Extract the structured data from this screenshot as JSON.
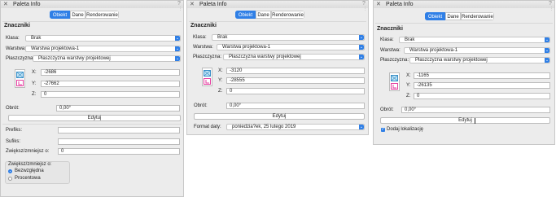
{
  "window_title": "Paleta Info",
  "help_glyph": "?",
  "tabs": [
    "Obiekt",
    "Dane",
    "Renderowanie"
  ],
  "section_title": "Znaczniki",
  "labels": {
    "klasa": "Klasa:",
    "warstwa": "Warstwa:",
    "plaszczyzna": "Płaszczyzna:",
    "x": "X:",
    "y": "Y:",
    "z": "Z:",
    "obrot": "Obrót:",
    "edytuj": "Edytuj",
    "prefiks": "Prefiks:",
    "sufiks": "Sufiks:",
    "zwieksz": "Zwiększ/zmniejsz o:",
    "zwieksz_group": "Zwiększ/zmniejsz o:",
    "bezwzgledna": "Bezwzględna",
    "procentowa": "Procentowa",
    "format_daty": "Format daty:",
    "dodaj_lokalizacje": "Dodaj lokalizację"
  },
  "common": {
    "klasa_value": "Brak",
    "warstwa_value": "Warstwa projektowa-1",
    "plaszczyzna_value": "Płaszczyzna warstwy projektowej",
    "z_value": "0",
    "obrot_value": "0,00°"
  },
  "panel1": {
    "x": "-2686",
    "y": "-27662",
    "zwieksz_value": "0"
  },
  "panel2": {
    "x": "-3120",
    "y": "-28555",
    "format_daty_value": "poniedzia?ek, 25 lutego 2019"
  },
  "panel3": {
    "x": "-1165",
    "y": "-26135"
  },
  "colors": {
    "accent": "#2f7fe6",
    "panel_bg": "#ececec"
  },
  "icons": [
    "close-icon",
    "help-icon",
    "position-anchor-icon",
    "chevron-down-icon"
  ]
}
